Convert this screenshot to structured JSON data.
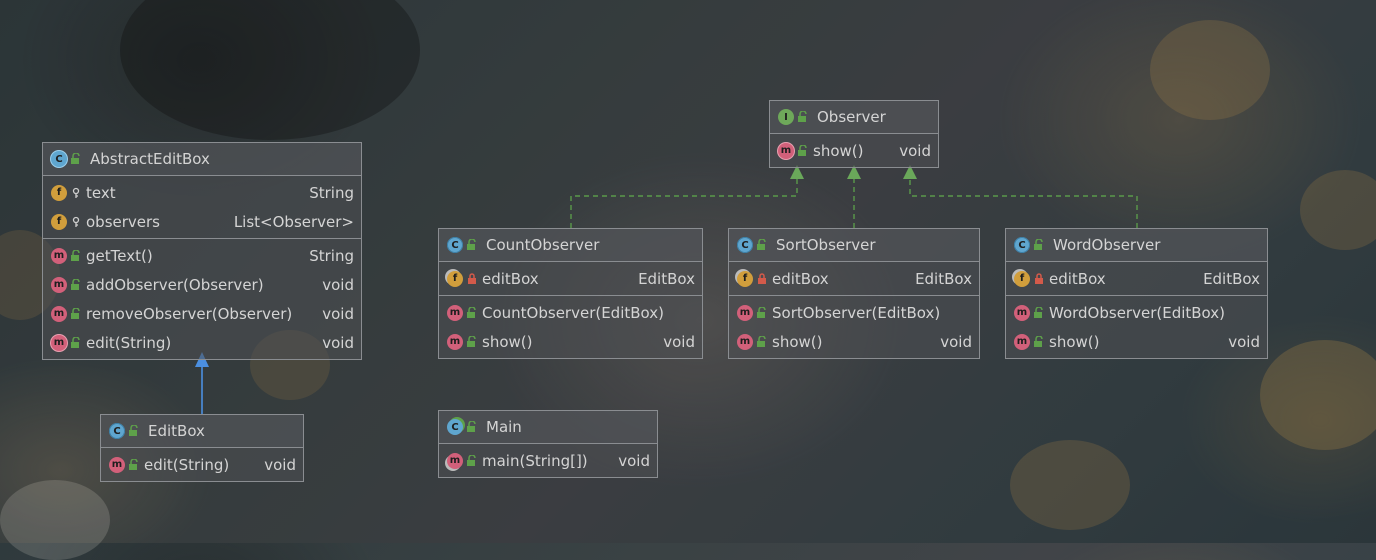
{
  "colors": {
    "inheritance_arrow": "#4b8fe0",
    "realization_arrow": "#5a9a4a",
    "class_icon": "#5fa6cf",
    "interface_icon": "#6ea85a",
    "field_icon": "#d19e3c",
    "method_icon": "#d2607a"
  },
  "classes": {
    "abstract_edit_box": {
      "kind_letter": "C",
      "name": "AbstractEditBox",
      "fields": [
        {
          "icon_letter": "f",
          "name": "text",
          "type": "String",
          "visibility": "private-key"
        },
        {
          "icon_letter": "f",
          "name": "observers",
          "type": "List<Observer>",
          "visibility": "private-key"
        }
      ],
      "methods": [
        {
          "icon_letter": "m",
          "name": "getText()",
          "type": "String"
        },
        {
          "icon_letter": "m",
          "name": "addObserver(Observer)",
          "type": "void"
        },
        {
          "icon_letter": "m",
          "name": "removeObserver(Observer)",
          "type": "void"
        },
        {
          "icon_letter": "m",
          "name": "edit(String)",
          "type": "void"
        }
      ]
    },
    "edit_box": {
      "kind_letter": "C",
      "name": "EditBox",
      "methods": [
        {
          "icon_letter": "m",
          "name": "edit(String)",
          "type": "void"
        }
      ]
    },
    "observer": {
      "kind_letter": "I",
      "name": "Observer",
      "methods": [
        {
          "icon_letter": "m",
          "name": "show()",
          "type": "void"
        }
      ]
    },
    "count_observer": {
      "kind_letter": "C",
      "name": "CountObserver",
      "fields": [
        {
          "icon_letter": "f",
          "name": "editBox",
          "type": "EditBox",
          "visibility": "private-lock"
        }
      ],
      "methods": [
        {
          "icon_letter": "m",
          "name": "CountObserver(EditBox)",
          "type": ""
        },
        {
          "icon_letter": "m",
          "name": "show()",
          "type": "void"
        }
      ]
    },
    "sort_observer": {
      "kind_letter": "C",
      "name": "SortObserver",
      "fields": [
        {
          "icon_letter": "f",
          "name": "editBox",
          "type": "EditBox",
          "visibility": "private-lock"
        }
      ],
      "methods": [
        {
          "icon_letter": "m",
          "name": "SortObserver(EditBox)",
          "type": ""
        },
        {
          "icon_letter": "m",
          "name": "show()",
          "type": "void"
        }
      ]
    },
    "word_observer": {
      "kind_letter": "C",
      "name": "WordObserver",
      "fields": [
        {
          "icon_letter": "f",
          "name": "editBox",
          "type": "EditBox",
          "visibility": "private-lock"
        }
      ],
      "methods": [
        {
          "icon_letter": "m",
          "name": "WordObserver(EditBox)",
          "type": ""
        },
        {
          "icon_letter": "m",
          "name": "show()",
          "type": "void"
        }
      ]
    },
    "main": {
      "kind_letter": "C",
      "name": "Main",
      "methods": [
        {
          "icon_letter": "m",
          "name": "main(String[])",
          "type": "void"
        }
      ]
    }
  },
  "relations": [
    {
      "from": "EditBox",
      "to": "AbstractEditBox",
      "kind": "generalization"
    },
    {
      "from": "CountObserver",
      "to": "Observer",
      "kind": "realization"
    },
    {
      "from": "SortObserver",
      "to": "Observer",
      "kind": "realization"
    },
    {
      "from": "WordObserver",
      "to": "Observer",
      "kind": "realization"
    }
  ]
}
